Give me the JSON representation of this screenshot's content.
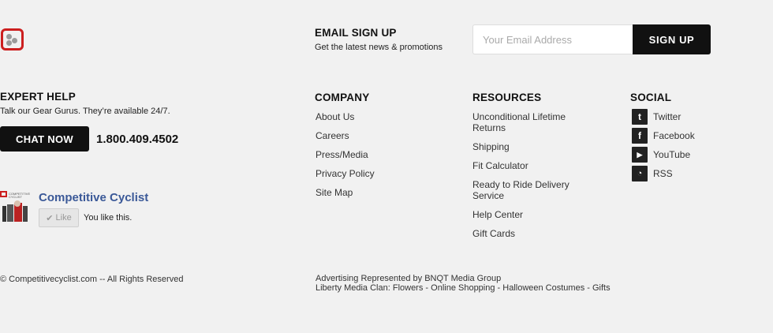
{
  "brand": {
    "logo": "brand-logo-icon"
  },
  "email_signup": {
    "heading": "EMAIL SIGN UP",
    "subtext": "Get the latest news & promotions",
    "placeholder": "Your Email Address",
    "button_label": "SIGN UP"
  },
  "expert_help": {
    "heading": "EXPERT HELP",
    "subtext": "Talk our Gear Gurus. They’re available 24/7.",
    "chat_label": "CHAT NOW",
    "phone": "1.800.409.4502"
  },
  "facebook": {
    "page_name": "Competitive Cyclist",
    "badge_text": "COMPETITIVE CYCLIST",
    "like_label": "Like",
    "like_status": "You like this."
  },
  "company": {
    "heading": "COMPANY",
    "links": [
      "About Us",
      "Careers",
      "Press/Media",
      "Privacy Policy",
      "Site Map"
    ]
  },
  "resources": {
    "heading": "RESOURCES",
    "links": [
      "Unconditional Lifetime Returns",
      "Shipping",
      "Fit Calculator",
      "Ready to Ride Delivery Service",
      "Help Center",
      "Gift Cards"
    ]
  },
  "social": {
    "heading": "SOCIAL",
    "items": [
      {
        "label": "Twitter",
        "icon": "twitter-icon",
        "glyph": "t"
      },
      {
        "label": "Facebook",
        "icon": "facebook-icon",
        "glyph": "f"
      },
      {
        "label": "YouTube",
        "icon": "youtube-icon",
        "glyph": "▶"
      },
      {
        "label": "RSS",
        "icon": "rss-icon",
        "glyph": "◔"
      }
    ]
  },
  "footer": {
    "copyright": "© Competitivecyclist.com -- All Rights Reserved",
    "advertising": "Advertising Represented by BNQT Media Group",
    "clan_prefix": "Liberty Media Clan:",
    "clan_links": [
      "Flowers",
      "Online Shopping",
      "Halloween Costumes",
      "Gifts"
    ],
    "separator": " - "
  },
  "colors": {
    "background": "#f1f1f1",
    "accent": "#cc1f1f",
    "button": "#111111",
    "facebook": "#3b5998"
  }
}
